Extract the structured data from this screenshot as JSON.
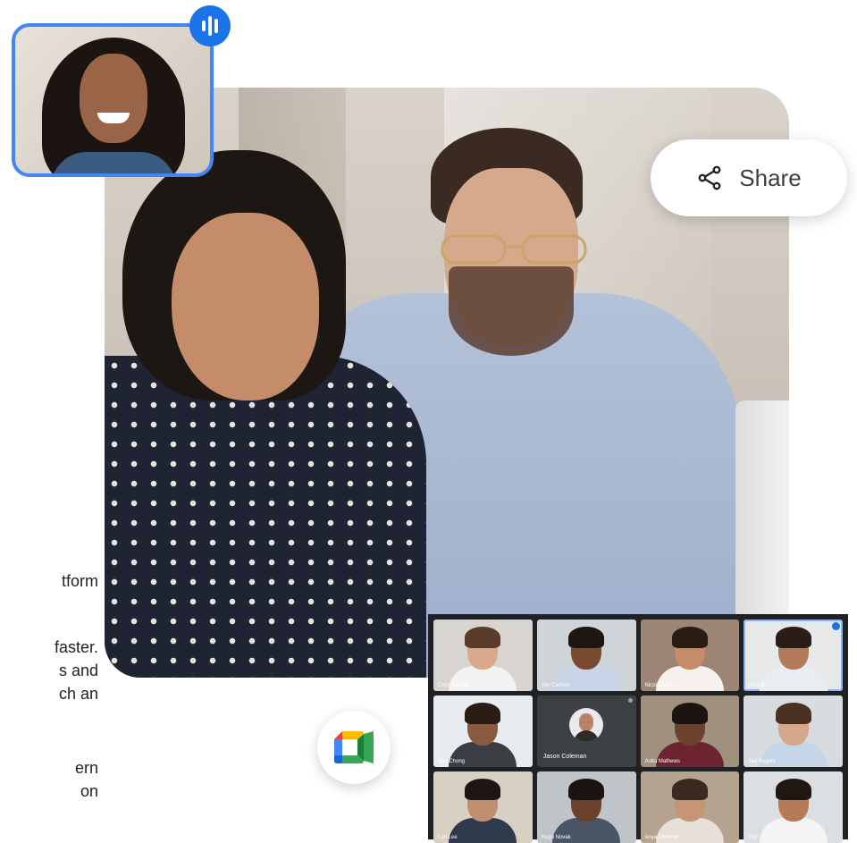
{
  "left_text": {
    "line1": "tform",
    "line2a": "faster.",
    "line2b": "s and",
    "line2c": "ch an",
    "line3a": "ern",
    "line3b": "on"
  },
  "share": {
    "label": "Share",
    "icon": "share-icon"
  },
  "speaking_indicator": {
    "icon": "audio-bars-icon",
    "color": "#1a73e8"
  },
  "meet_logo": {
    "icon": "google-meet-logo"
  },
  "colors": {
    "accent": "#4285f4",
    "grid_bg": "#202124"
  },
  "participants": [
    {
      "name": "Chris Garcia",
      "bg": "#d8d4cf",
      "skin": "#d9a98b",
      "hair": "#5b3b2a",
      "shirt": "#f2f2f2"
    },
    {
      "name": "Joe Carlson",
      "bg": "#cfd4d8",
      "skin": "#7a4a33",
      "hair": "#1e1510",
      "shirt": "#c7d3e6"
    },
    {
      "name": "Nicole Jones",
      "bg": "#9c8574",
      "skin": "#c58b6a",
      "hair": "#2a1b13",
      "shirt": "#f5f1ec"
    },
    {
      "name": "Jo Hall",
      "bg": "#e6e8ea",
      "skin": "#b27a58",
      "hair": "#2a1d16",
      "shirt": "#e9edf1",
      "active": true
    },
    {
      "name": "Ann Chong",
      "bg": "#e7ecf0",
      "skin": "#8a5a40",
      "hair": "#2a1c14",
      "shirt": "#3b3d44"
    },
    {
      "name": "Jason Coleman",
      "dark": true
    },
    {
      "name": "Anita Mathews",
      "bg": "#a0907e",
      "skin": "#6b432d",
      "hair": "#1c1410",
      "shirt": "#6b2430"
    },
    {
      "name": "Jad Rogers",
      "bg": "#d9dcdf",
      "skin": "#d6a78a",
      "hair": "#4a3223",
      "shirt": "#c5d6e8"
    },
    {
      "name": "Lori Lee",
      "bg": "#d9d0c4",
      "skin": "#c18f6f",
      "hair": "#1e1612",
      "shirt": "#2f3a4c"
    },
    {
      "name": "Hugo Novak",
      "bg": "#bfc4c8",
      "skin": "#6a422c",
      "hair": "#1a1310",
      "shirt": "#4a5566"
    },
    {
      "name": "Anya Chesher",
      "bg": "#b5a28f",
      "skin": "#c69576",
      "hair": "#3a2a1f",
      "shirt": "#e6e0d8"
    },
    {
      "name": "You",
      "bg": "#dcdfe2",
      "skin": "#b57b58",
      "hair": "#1f1712",
      "shirt": "#f4f4f4"
    }
  ]
}
